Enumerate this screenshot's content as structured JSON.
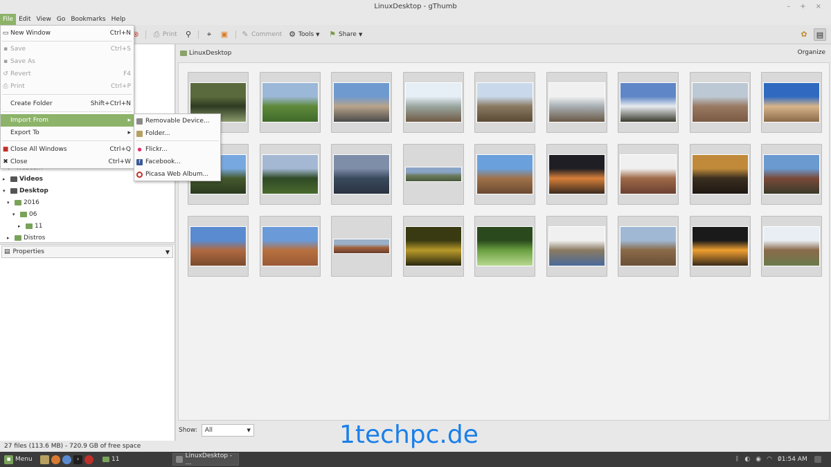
{
  "window": {
    "title": "LinuxDesktop - gThumb",
    "controls": [
      "–",
      "+",
      "×"
    ]
  },
  "menubar": [
    "File",
    "Edit",
    "View",
    "Go",
    "Bookmarks",
    "Help"
  ],
  "toolbar": {
    "print": "Print",
    "comment": "Comment",
    "tools": "Tools",
    "share": "Share"
  },
  "file_menu": {
    "new_window": {
      "label": "New Window",
      "shortcut": "Ctrl+N"
    },
    "save": {
      "label": "Save",
      "shortcut": "Ctrl+S"
    },
    "save_as": {
      "label": "Save As",
      "shortcut": ""
    },
    "revert": {
      "label": "Revert",
      "shortcut": "F4"
    },
    "print": {
      "label": "Print",
      "shortcut": "Ctrl+P"
    },
    "create_folder": {
      "label": "Create Folder",
      "shortcut": "Shift+Ctrl+N"
    },
    "import_from": {
      "label": "Import From"
    },
    "export_to": {
      "label": "Export To"
    },
    "close_all": {
      "label": "Close All Windows",
      "shortcut": "Ctrl+Q"
    },
    "close": {
      "label": "Close",
      "shortcut": "Ctrl+W"
    }
  },
  "import_submenu": [
    "Removable Device...",
    "Folder...",
    "Flickr...",
    "Facebook...",
    "Picasa Web Album..."
  ],
  "tree": {
    "webcam": "Webcam",
    "videos": "Videos",
    "desktop": "Desktop",
    "y2016": "2016",
    "m06": "06",
    "d11": "11",
    "distros": "Distros"
  },
  "properties_label": "Properties",
  "location": {
    "folder": "LinuxDesktop",
    "organize": "Organize"
  },
  "show": {
    "label": "Show:",
    "value": "All"
  },
  "status": "27 files (113.6 MB) - 720.9 GB of free space",
  "taskbar": {
    "menu": "Menu",
    "folder": "11",
    "window": "LinuxDesktop - ...",
    "clock": "01:54 AM"
  },
  "watermark": "1techpc.de",
  "colors": {
    "accent": "#8cb369",
    "folder": "#7aa35a",
    "taskbar": "#3b3b3b",
    "watermark": "#1a7fe8"
  },
  "thumbnails": [
    {
      "aspect": "landscape",
      "colors": [
        "#5a6a3c",
        "#2f3a22",
        "#8a9a6a"
      ]
    },
    {
      "aspect": "landscape",
      "colors": [
        "#9cb8d8",
        "#5f8a3a",
        "#3f6a2a"
      ]
    },
    {
      "aspect": "landscape",
      "colors": [
        "#6f9ad0",
        "#b8a48a",
        "#4a4a4a"
      ]
    },
    {
      "aspect": "landscape",
      "colors": [
        "#e6eef6",
        "#9aa6a0",
        "#6f5a44"
      ]
    },
    {
      "aspect": "landscape",
      "colors": [
        "#c9d8ea",
        "#8a7a62",
        "#5a4a36"
      ]
    },
    {
      "aspect": "landscape",
      "colors": [
        "#f0f0f0",
        "#a8b0b4",
        "#6a5846"
      ]
    },
    {
      "aspect": "landscape",
      "colors": [
        "#5f86c6",
        "#e8ecef",
        "#3a3a2e"
      ]
    },
    {
      "aspect": "landscape",
      "colors": [
        "#bcc8d4",
        "#9a7a62",
        "#7a5a44"
      ]
    },
    {
      "aspect": "landscape",
      "colors": [
        "#2f6ac0",
        "#d8b58a",
        "#8a6a4a"
      ]
    },
    {
      "aspect": "landscape",
      "colors": [
        "#78a8e0",
        "#445a2e",
        "#2a3a1e"
      ]
    },
    {
      "aspect": "landscape",
      "colors": [
        "#a4b8d4",
        "#2f4a26",
        "#4a6a2e"
      ]
    },
    {
      "aspect": "landscape",
      "colors": [
        "#7f8ea8",
        "#3a4a5e",
        "#2a3240"
      ]
    },
    {
      "aspect": "panorama",
      "colors": [
        "#8aa4c6",
        "#6a7a5a",
        "#4a5a3e"
      ]
    },
    {
      "aspect": "landscape",
      "colors": [
        "#6aa0dc",
        "#a0724a",
        "#6a4a30"
      ]
    },
    {
      "aspect": "landscape",
      "colors": [
        "#1e1e24",
        "#d8803a",
        "#3a2a1e"
      ]
    },
    {
      "aspect": "landscape",
      "colors": [
        "#f0f0f0",
        "#a06a4a",
        "#6a4030"
      ]
    },
    {
      "aspect": "landscape",
      "colors": [
        "#c08a3a",
        "#3a2e20",
        "#1e1812"
      ]
    },
    {
      "aspect": "landscape",
      "colors": [
        "#6a9ad0",
        "#7a4a3a",
        "#3a3a2a"
      ]
    },
    {
      "aspect": "landscape",
      "colors": [
        "#5a8ad0",
        "#b06a40",
        "#7a4a2e"
      ]
    },
    {
      "aspect": "landscape",
      "colors": [
        "#6a9ad8",
        "#b8703e",
        "#9a5a36"
      ]
    },
    {
      "aspect": "panorama",
      "colors": [
        "#9ab0c8",
        "#a0603a",
        "#6a4030"
      ]
    },
    {
      "aspect": "landscape",
      "colors": [
        "#3a3a12",
        "#b89a2a",
        "#2a2a10"
      ]
    },
    {
      "aspect": "landscape",
      "colors": [
        "#2a4a1e",
        "#6aa040",
        "#b8d890"
      ]
    },
    {
      "aspect": "landscape",
      "colors": [
        "#f0f0f0",
        "#8a7a62",
        "#4a6a9a"
      ]
    },
    {
      "aspect": "landscape",
      "colors": [
        "#a0b8d4",
        "#8a6a48",
        "#6a5038"
      ]
    },
    {
      "aspect": "landscape",
      "colors": [
        "#1a1a1a",
        "#f0a030",
        "#3a2a1a"
      ]
    },
    {
      "aspect": "landscape",
      "colors": [
        "#e8eef4",
        "#8a6a4a",
        "#6a7a4a"
      ]
    }
  ]
}
